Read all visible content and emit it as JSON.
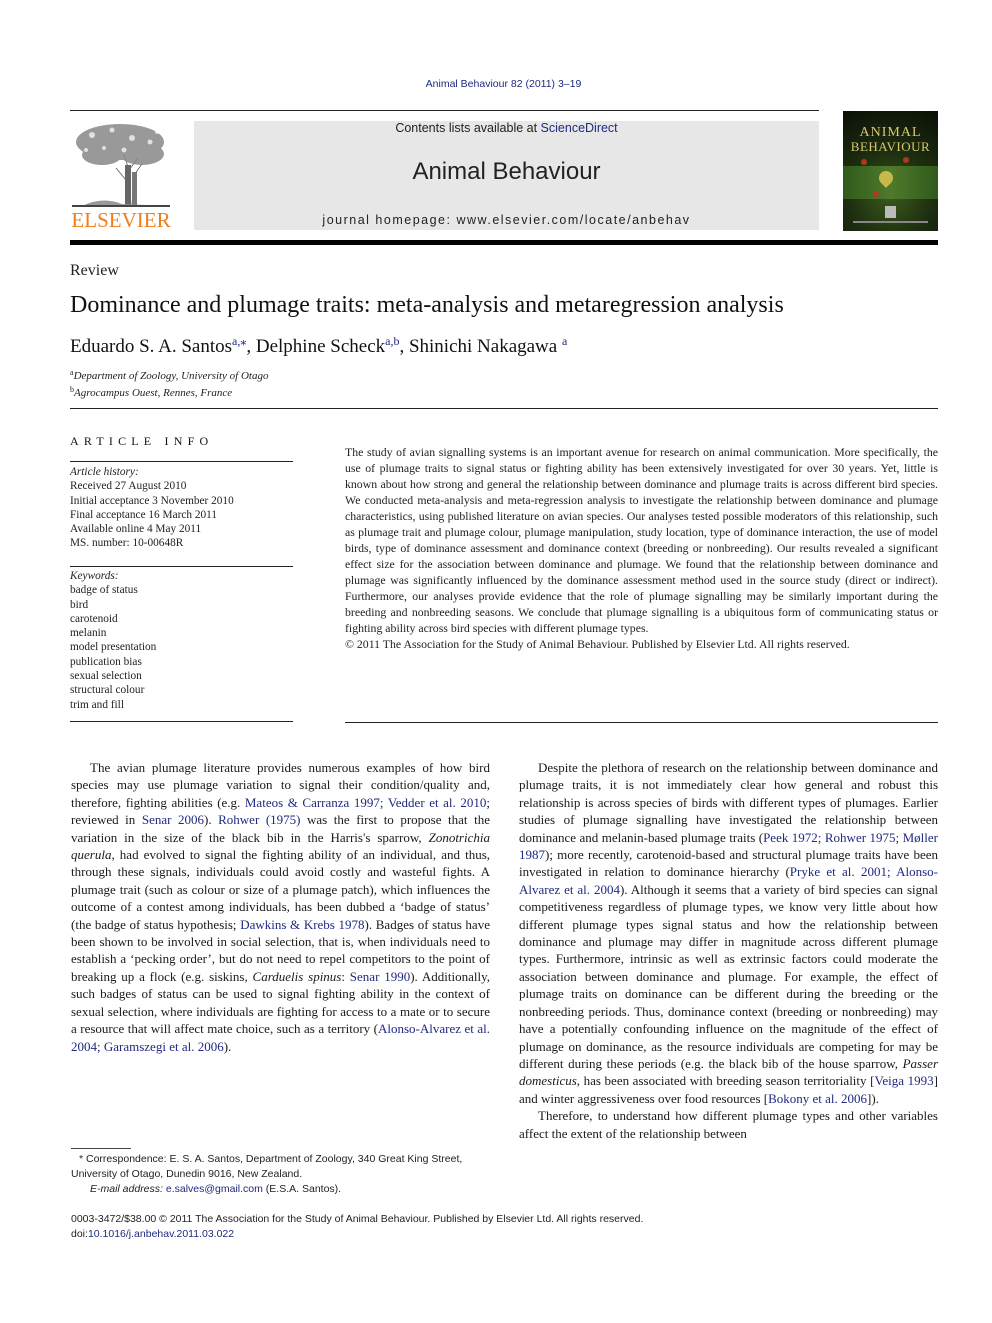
{
  "citation": "Animal Behaviour 82 (2011) 3–19",
  "header": {
    "publisher_logo_text": "ELSEVIER",
    "contents_prefix": "Contents lists available at ",
    "contents_link": "ScienceDirect",
    "journal_title": "Animal Behaviour",
    "homepage_label": "journal homepage: ",
    "homepage_url": "www.elsevier.com/locate/anbehav",
    "cover_title_line1": "ANIMAL",
    "cover_title_line2": "BEHAVIOUR",
    "colors": {
      "elsevier_orange": "#f07d1a",
      "link_blue": "#1f2a80",
      "header_box": "#e7e7e7"
    }
  },
  "article": {
    "section_type": "Review",
    "title": "Dominance and plumage traits: meta-analysis and metaregression analysis",
    "authors": [
      {
        "name": "Eduardo S. A. Santos",
        "sup": "a,⁎",
        "sep": ", "
      },
      {
        "name": "Delphine Scheck",
        "sup": "a,b",
        "sep": ", "
      },
      {
        "name": "Shinichi Nakagawa",
        "sup": "a",
        "sep": ""
      }
    ],
    "affiliations": [
      {
        "mark": "a",
        "text": "Department of Zoology, University of Otago"
      },
      {
        "mark": "b",
        "text": "Agrocampus Ouest, Rennes, France"
      }
    ]
  },
  "article_info": {
    "heading": "ARTICLE INFO",
    "history_label": "Article history:",
    "history": [
      "Received 27 August 2010",
      "Initial acceptance 3 November 2010",
      "Final acceptance 16 March 2011",
      "Available online 4 May 2011",
      "MS. number: 10-00648R"
    ],
    "keywords_label": "Keywords:",
    "keywords": [
      "badge of status",
      "bird",
      "carotenoid",
      "melanin",
      "model presentation",
      "publication bias",
      "sexual selection",
      "structural colour",
      "trim and fill"
    ]
  },
  "abstract": {
    "text": "The study of avian signalling systems is an important avenue for research on animal communication. More specifically, the use of plumage traits to signal status or fighting ability has been extensively investigated for over 30 years. Yet, little is known about how strong and general the relationship between dominance and plumage traits is across different bird species. We conducted meta-analysis and meta-regression analysis to investigate the relationship between dominance and plumage characteristics, using published literature on avian species. Our analyses tested possible moderators of this relationship, such as plumage trait and plumage colour, plumage manipulation, study location, type of dominance interaction, the use of model birds, type of dominance assessment and dominance context (breeding or nonbreeding). Our results revealed a significant effect size for the association between dominance and plumage. We found that the relationship between dominance and plumage was significantly influenced by the dominance assessment method used in the source study (direct or indirect). Furthermore, our analyses provide evidence that the role of plumage signalling may be similarly important during the breeding and nonbreeding seasons. We conclude that plumage signalling is a ubiquitous form of communicating status or fighting ability across bird species with different plumage types.",
    "copyright": "© 2011 The Association for the Study of Animal Behaviour. Published by Elsevier Ltd. All rights reserved."
  },
  "body_left": {
    "p1": [
      {
        "t": "The avian plumage literature provides numerous examples of how bird species may use plumage variation to signal their condition/quality and, therefore, fighting abilities (e.g. "
      },
      {
        "link": "Mateos & Carranza 1997; Vedder et al. 2010"
      },
      {
        "t": "; reviewed in "
      },
      {
        "link": "Senar 2006"
      },
      {
        "t": "). "
      },
      {
        "link": "Rohwer (1975)"
      },
      {
        "t": " was the first to propose that the variation in the size of the black bib in the Harris's sparrow, "
      },
      {
        "i": "Zonotrichia querula"
      },
      {
        "t": ", had evolved to signal the fighting ability of an individual, and thus, through these signals, individuals could avoid costly and wasteful fights. A plumage trait (such as colour or size of a plumage patch), which influences the outcome of a contest among individuals, has been dubbed a ‘badge of status’ (the badge of status hypothesis; "
      },
      {
        "link": "Dawkins & Krebs 1978"
      },
      {
        "t": "). Badges of status have been shown to be involved in social selection, that is, when individuals need to establish a ‘pecking order’, but do not need to repel competitors to the point of breaking up a flock (e.g. siskins, "
      },
      {
        "i": "Carduelis spinus"
      },
      {
        "t": ": "
      },
      {
        "link": "Senar 1990"
      },
      {
        "t": "). Additionally, such badges of status can be used to signal fighting ability in the context of sexual selection, where individuals are fighting for access to a mate or to secure a resource that will affect mate choice, such as a territory ("
      },
      {
        "link": "Alonso-Alvarez et al. 2004; Garamszegi et al. 2006"
      },
      {
        "t": ")."
      }
    ]
  },
  "body_right": {
    "p1": [
      {
        "t": "Despite the plethora of research on the relationship between dominance and plumage traits, it is not immediately clear how general and robust this relationship is across species of birds with different types of plumages. Earlier studies of plumage signalling have investigated the relationship between dominance and melanin-based plumage traits ("
      },
      {
        "link": "Peek 1972; Rohwer 1975; Møller 1987"
      },
      {
        "t": "); more recently, carotenoid-based and structural plumage traits have been investigated in relation to dominance hierarchy ("
      },
      {
        "link": "Pryke et al. 2001; Alonso-Alvarez et al. 2004"
      },
      {
        "t": "). Although it seems that a variety of bird species can signal competitiveness regardless of plumage types, we know very little about how different plumage types signal status and how the relationship between dominance and plumage may differ in magnitude across different plumage types. Furthermore, intrinsic as well as extrinsic factors could moderate the association between dominance and plumage. For example, the effect of plumage traits on dominance can be different during the breeding or the nonbreeding periods. Thus, dominance context (breeding or nonbreeding) may have a potentially confounding influence on the magnitude of the effect of plumage on dominance, as the resource individuals are competing for may be different during these periods (e.g. the black bib of the house sparrow, "
      },
      {
        "i": "Passer domesticus"
      },
      {
        "t": ", has been associated with breeding season territoriality ["
      },
      {
        "link": "Veiga 1993"
      },
      {
        "t": "] and winter aggressiveness over food resources ["
      },
      {
        "link": "Bokony et al. 2006"
      },
      {
        "t": "])."
      }
    ],
    "p2": [
      {
        "t": "Therefore, to understand how different plumage types and other variables affect the extent of the relationship between"
      }
    ]
  },
  "footnote": {
    "mark": "*",
    "correspondence": " Correspondence: E. S. A. Santos, Department of Zoology, 340 Great King Street, University of Otago, Dunedin 9016, New Zealand.",
    "email_label": "E-mail address: ",
    "email": "e.salves@gmail.com",
    "email_suffix": " (E.S.A. Santos)."
  },
  "bottom": {
    "issn_line": "0003-3472/$38.00 © 2011 The Association for the Study of Animal Behaviour. Published by Elsevier Ltd. All rights reserved.",
    "doi_label": "doi:",
    "doi": "10.1016/j.anbehav.2011.03.022"
  }
}
